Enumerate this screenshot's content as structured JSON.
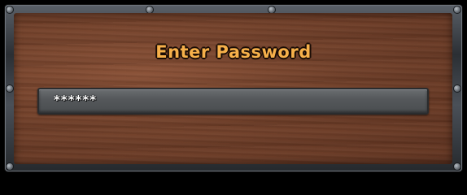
{
  "dialog": {
    "title": "Enter Password",
    "password_field": {
      "value": "******"
    }
  },
  "colors": {
    "title_text": "#f6b04a",
    "wood": "#70402a",
    "input_bar": "#55585b"
  }
}
